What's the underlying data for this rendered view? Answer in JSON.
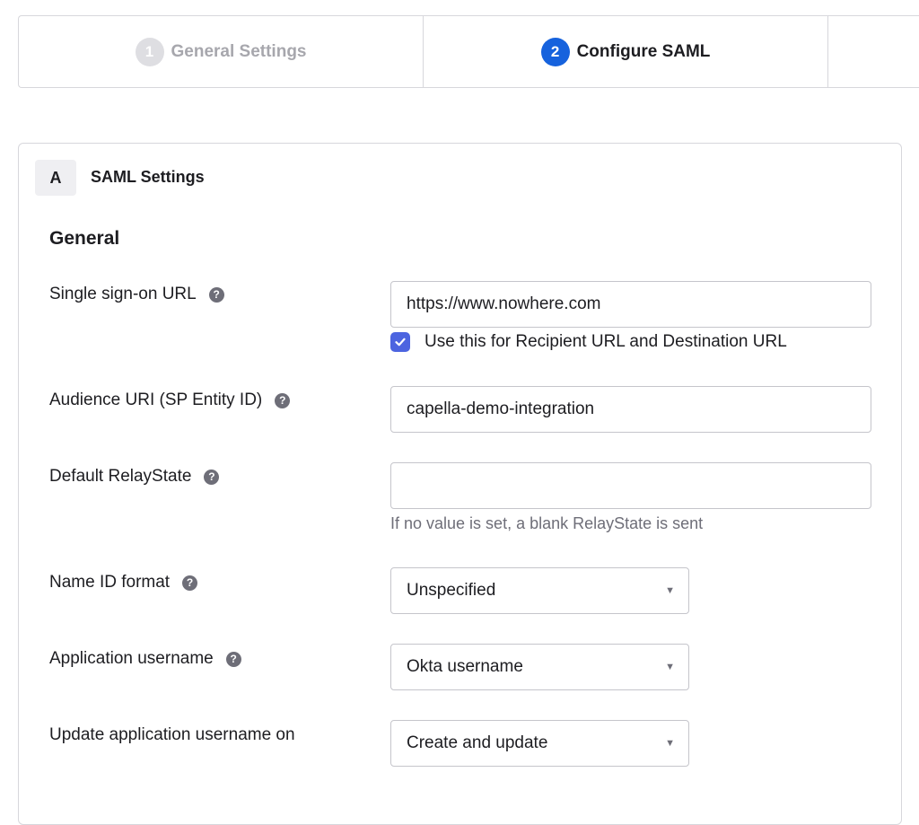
{
  "wizard": {
    "steps": [
      {
        "number": "1",
        "label": "General Settings"
      },
      {
        "number": "2",
        "label": "Configure SAML"
      }
    ]
  },
  "section": {
    "letter": "A",
    "title": "SAML Settings",
    "group_title": "General"
  },
  "fields": {
    "sso_url": {
      "label": "Single sign-on URL",
      "value": "https://www.nowhere.com",
      "checkbox_label": "Use this for Recipient URL and Destination URL",
      "checkbox_checked": true
    },
    "audience_uri": {
      "label": "Audience URI (SP Entity ID)",
      "value": "capella-demo-integration"
    },
    "relay_state": {
      "label": "Default RelayState",
      "value": "",
      "hint": "If no value is set, a blank RelayState is sent"
    },
    "name_id_format": {
      "label": "Name ID format",
      "selected": "Unspecified"
    },
    "app_username": {
      "label": "Application username",
      "selected": "Okta username"
    },
    "update_username_on": {
      "label": "Update application username on",
      "selected": "Create and update"
    }
  },
  "icons": {
    "help": "question-circle-icon",
    "caret": "caret-down-icon",
    "check": "checkmark-icon"
  },
  "colors": {
    "active_step": "#1662dd",
    "inactive_step": "#dedee2",
    "checkbox": "#4c64e0"
  }
}
